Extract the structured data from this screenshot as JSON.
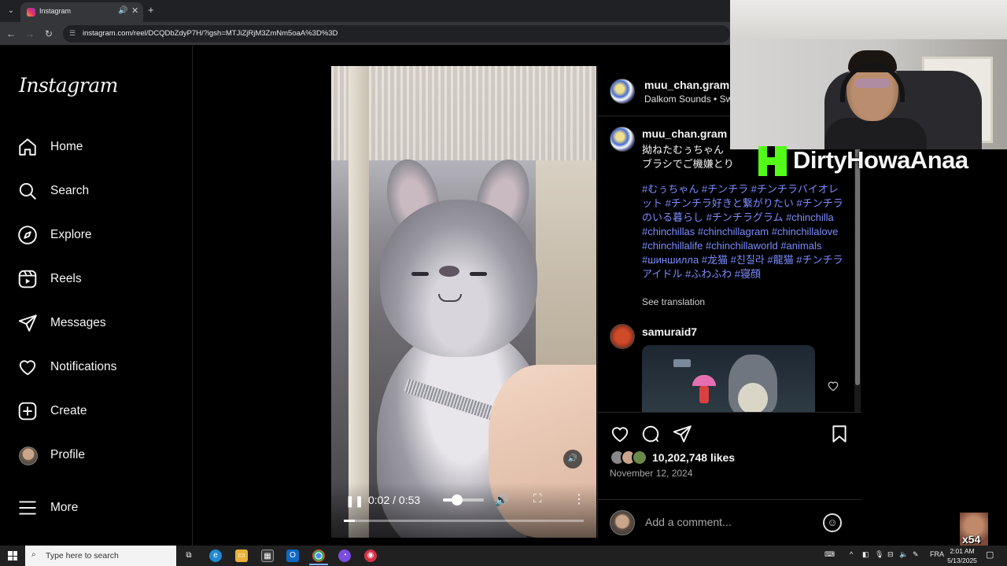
{
  "browser": {
    "tab_title": "Instagram",
    "url": "instagram.com/reel/DCQDbZdyP7H/?igsh=MTJiZjRjM3ZmNm5oaA%3D%3D"
  },
  "sidebar": {
    "logo": "Instagram",
    "items": [
      {
        "label": "Home",
        "icon": "home-icon"
      },
      {
        "label": "Search",
        "icon": "search-icon"
      },
      {
        "label": "Explore",
        "icon": "compass-icon"
      },
      {
        "label": "Reels",
        "icon": "reels-icon"
      },
      {
        "label": "Messages",
        "icon": "send-icon"
      },
      {
        "label": "Notifications",
        "icon": "heart-icon"
      },
      {
        "label": "Create",
        "icon": "plus-square-icon"
      },
      {
        "label": "Profile",
        "icon": "avatar"
      }
    ],
    "more_label": "More"
  },
  "video": {
    "time": "0:02 / 0:53",
    "progress": 0.045,
    "volume": 0.35,
    "state": "playing"
  },
  "post": {
    "username": "muu_chan.gram",
    "audio": "Dalkom Sounds • Sw",
    "caption_line1": "拗ねたむぅちゃん",
    "caption_line2": "ブラシでご機嫌とり",
    "hashtags": "#むぅちゃん #チンチラ #チンチラバイオレット #チンチラ好きと繋がりたい #チンチラのいる暮らし #チンチラグラム #chinchilla #chinchillas #chinchillagram #chinchillalove #chinchillalife #chinchillaworld #animals #шиншилла #龙猫 #친칠라 #龍猫 #チンチラアイドル #ふわふわ #寝顔",
    "see_translation": "See translation",
    "comment_user": "samuraid7",
    "likes": "10,202,748 likes",
    "date": "November 12, 2024",
    "comment_placeholder": "Add a comment..."
  },
  "stream": {
    "name": "DirtyHowaAnaa",
    "brand_color": "#53fc18",
    "badge": "x54"
  },
  "taskbar": {
    "search_placeholder": "Type here to search",
    "lang": "FRA",
    "time": "2:01 AM",
    "date": "5/13/2025"
  }
}
